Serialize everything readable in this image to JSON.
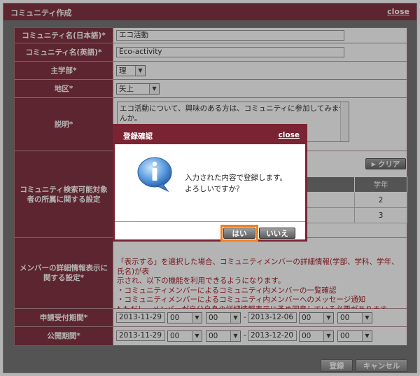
{
  "window": {
    "title": "コミュニティ作成",
    "close": "close"
  },
  "fields": {
    "name_ja": {
      "label": "コミュニティ名(日本語)*",
      "value": "エコ活動"
    },
    "name_en": {
      "label": "コミュニティ名(英語)*",
      "value": "Eco-activity"
    },
    "faculty": {
      "label": "主学部*",
      "value": "理"
    },
    "area": {
      "label": "地区*",
      "value": "矢上"
    },
    "description": {
      "label": "説明*",
      "value": "エコ活動について、興味のある方は、コミュニティに参加してみませんか。"
    },
    "search_target": {
      "label": "コミュニティ検索可能対象者の所属に関する設定",
      "clear_button": "クリア",
      "table_header_year": "学年",
      "rows": [
        "2",
        "3"
      ]
    },
    "member_detail": {
      "label": "メンバーの詳細情報表示に関する設定*",
      "lines": [
        "「表示する」を選択した場合、コミュニティメンバーの詳細情報(学部、学科、学年、氏名)が表",
        "示され、以下の機能を利用できるようになります。",
        "・コミュニティメンバーによるコミュニティ内メンバーの一覧確認",
        "・コミュニティメンバーによるコミュニティ内メンバーへのメッセージ通知",
        "* ただし、メンバーが自分自身の詳細情報表示に予め同意している必要があります。"
      ]
    },
    "apply_period": {
      "label": "申請受付期間*",
      "from_date": "2013-11-29",
      "from_h": "00",
      "from_m": "00",
      "sep": "-",
      "to_date": "2013-12-06",
      "to_h": "00",
      "to_m": "00"
    },
    "public_period": {
      "label": "公開期間*",
      "from_date": "2013-11-29",
      "from_h": "00",
      "from_m": "00",
      "sep": "-",
      "to_date": "2013-12-20",
      "to_h": "00",
      "to_m": "00"
    }
  },
  "footer": {
    "register": "登録",
    "cancel": "キャンセル"
  },
  "dialog": {
    "title": "登録確認",
    "close": "close",
    "message_line1": "入力された内容で登録します。",
    "message_line2": "よろしいですか？",
    "yes": "はい",
    "no": "いいえ"
  },
  "colors": {
    "maroon": "#7a2433",
    "focus": "#f08020",
    "note_red": "#a0101a"
  }
}
